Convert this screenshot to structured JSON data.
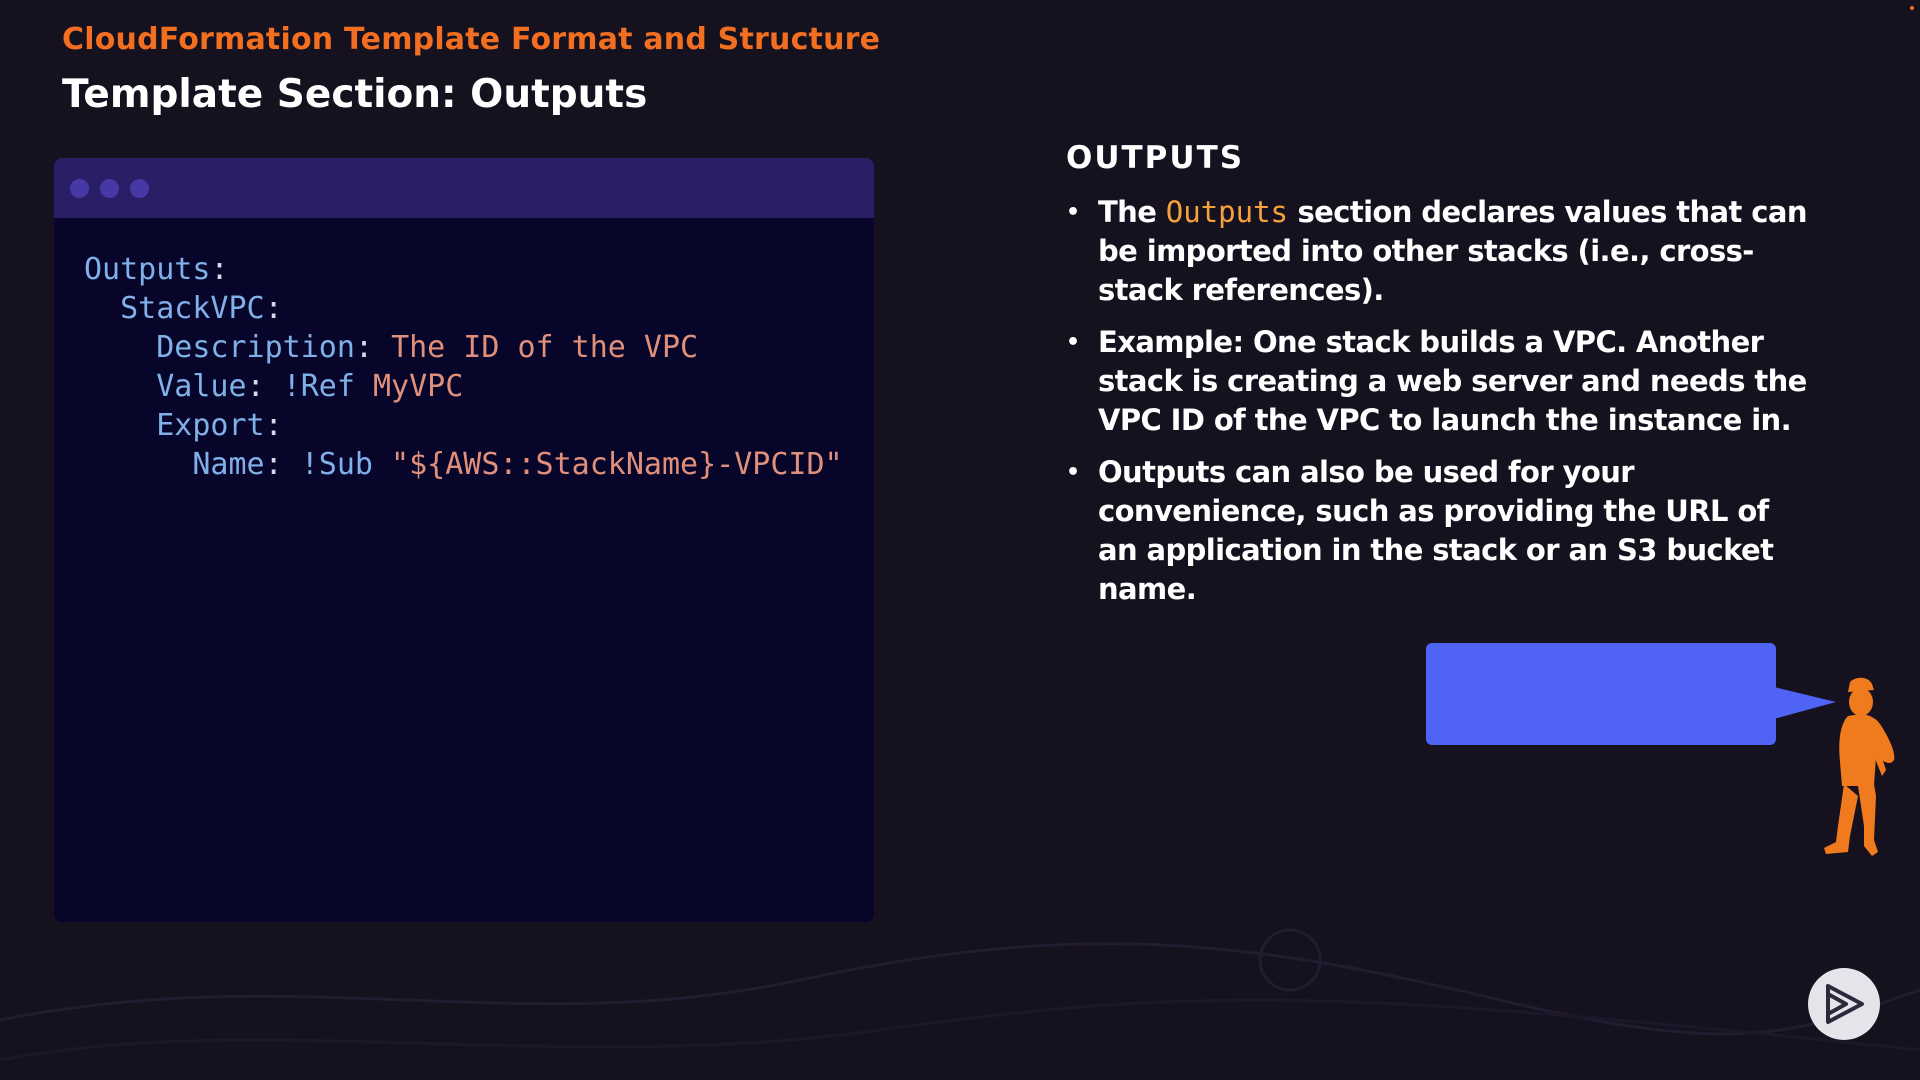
{
  "slide": {
    "subtitle": "CloudFormation Template Format and Structure",
    "title": "Template Section: Outputs"
  },
  "code_window": {
    "lines": [
      [
        {
          "t": "Outputs",
          "c": "key"
        },
        {
          "t": ":",
          "c": "punc"
        }
      ],
      [
        {
          "t": "  StackVPC",
          "c": "key"
        },
        {
          "t": ":",
          "c": "punc"
        }
      ],
      [
        {
          "t": "    Description",
          "c": "key"
        },
        {
          "t": ": ",
          "c": "punc"
        },
        {
          "t": "The ID of the VPC",
          "c": "val"
        }
      ],
      [
        {
          "t": "    Value",
          "c": "key"
        },
        {
          "t": ": ",
          "c": "punc"
        },
        {
          "t": "!Ref",
          "c": "tag"
        },
        {
          "t": " MyVPC",
          "c": "val"
        }
      ],
      [
        {
          "t": "    Export",
          "c": "key"
        },
        {
          "t": ":",
          "c": "punc"
        }
      ],
      [
        {
          "t": "      Name",
          "c": "key"
        },
        {
          "t": ": ",
          "c": "punc"
        },
        {
          "t": "!Sub",
          "c": "tag"
        },
        {
          "t": " \"${AWS::StackName}-VPCID\"",
          "c": "val"
        }
      ]
    ]
  },
  "notes": {
    "heading": "OUTPUTS",
    "bullet_marker": "•",
    "bullets": [
      {
        "pre": "The ",
        "code": "Outputs",
        "post": " section declares values that can be imported into other stacks (i.e., cross-stack references)."
      },
      {
        "pre": "Example: One stack builds a VPC. Another stack is creating a web server and needs the VPC ID of the VPC to launch the instance in.",
        "code": "",
        "post": ""
      },
      {
        "pre": "Outputs can also be used for your convenience, such as providing the URL of an application in the stack or an S3 bucket name.",
        "code": "",
        "post": ""
      }
    ]
  },
  "icons": {
    "play_button": "play-logo-icon",
    "presenter": "presenter-silhouette-icon"
  },
  "colors": {
    "accent_orange": "#f26f21",
    "code_inline": "#f5a23c",
    "bubble_blue": "#4f63f5",
    "code_bg": "#07052a",
    "code_bar": "#2a1f66",
    "background": "#15111f"
  }
}
